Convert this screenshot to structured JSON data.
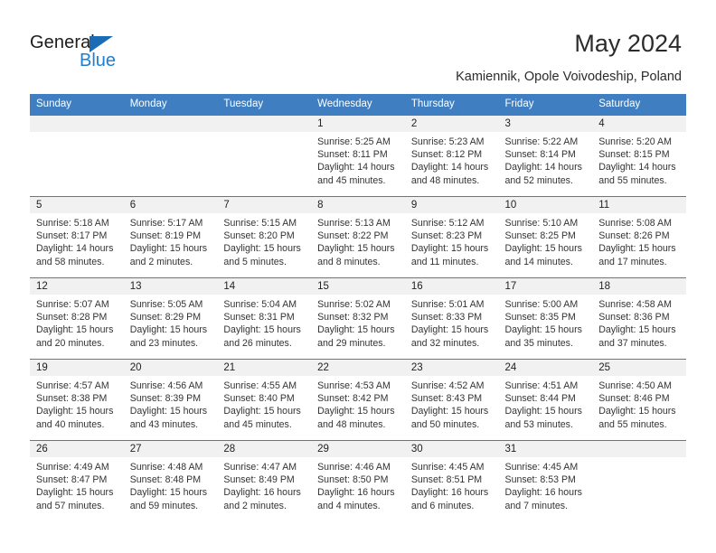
{
  "brand": {
    "name_top": "General",
    "name_bottom": "Blue",
    "logo_icon": "blue-triangle-icon",
    "accent_color": "#1c7fd0"
  },
  "header": {
    "title": "May 2024",
    "subtitle": "Kamiennik, Opole Voivodeship, Poland"
  },
  "calendar": {
    "header_bg": "#3f7fc1",
    "daynum_bg": "#f1f1f1",
    "weekday_headers": [
      "Sunday",
      "Monday",
      "Tuesday",
      "Wednesday",
      "Thursday",
      "Friday",
      "Saturday"
    ],
    "weeks": [
      [
        {
          "day": "",
          "lines": []
        },
        {
          "day": "",
          "lines": []
        },
        {
          "day": "",
          "lines": []
        },
        {
          "day": "1",
          "lines": [
            "Sunrise: 5:25 AM",
            "Sunset: 8:11 PM",
            "Daylight: 14 hours",
            "and 45 minutes."
          ]
        },
        {
          "day": "2",
          "lines": [
            "Sunrise: 5:23 AM",
            "Sunset: 8:12 PM",
            "Daylight: 14 hours",
            "and 48 minutes."
          ]
        },
        {
          "day": "3",
          "lines": [
            "Sunrise: 5:22 AM",
            "Sunset: 8:14 PM",
            "Daylight: 14 hours",
            "and 52 minutes."
          ]
        },
        {
          "day": "4",
          "lines": [
            "Sunrise: 5:20 AM",
            "Sunset: 8:15 PM",
            "Daylight: 14 hours",
            "and 55 minutes."
          ]
        }
      ],
      [
        {
          "day": "5",
          "lines": [
            "Sunrise: 5:18 AM",
            "Sunset: 8:17 PM",
            "Daylight: 14 hours",
            "and 58 minutes."
          ]
        },
        {
          "day": "6",
          "lines": [
            "Sunrise: 5:17 AM",
            "Sunset: 8:19 PM",
            "Daylight: 15 hours",
            "and 2 minutes."
          ]
        },
        {
          "day": "7",
          "lines": [
            "Sunrise: 5:15 AM",
            "Sunset: 8:20 PM",
            "Daylight: 15 hours",
            "and 5 minutes."
          ]
        },
        {
          "day": "8",
          "lines": [
            "Sunrise: 5:13 AM",
            "Sunset: 8:22 PM",
            "Daylight: 15 hours",
            "and 8 minutes."
          ]
        },
        {
          "day": "9",
          "lines": [
            "Sunrise: 5:12 AM",
            "Sunset: 8:23 PM",
            "Daylight: 15 hours",
            "and 11 minutes."
          ]
        },
        {
          "day": "10",
          "lines": [
            "Sunrise: 5:10 AM",
            "Sunset: 8:25 PM",
            "Daylight: 15 hours",
            "and 14 minutes."
          ]
        },
        {
          "day": "11",
          "lines": [
            "Sunrise: 5:08 AM",
            "Sunset: 8:26 PM",
            "Daylight: 15 hours",
            "and 17 minutes."
          ]
        }
      ],
      [
        {
          "day": "12",
          "lines": [
            "Sunrise: 5:07 AM",
            "Sunset: 8:28 PM",
            "Daylight: 15 hours",
            "and 20 minutes."
          ]
        },
        {
          "day": "13",
          "lines": [
            "Sunrise: 5:05 AM",
            "Sunset: 8:29 PM",
            "Daylight: 15 hours",
            "and 23 minutes."
          ]
        },
        {
          "day": "14",
          "lines": [
            "Sunrise: 5:04 AM",
            "Sunset: 8:31 PM",
            "Daylight: 15 hours",
            "and 26 minutes."
          ]
        },
        {
          "day": "15",
          "lines": [
            "Sunrise: 5:02 AM",
            "Sunset: 8:32 PM",
            "Daylight: 15 hours",
            "and 29 minutes."
          ]
        },
        {
          "day": "16",
          "lines": [
            "Sunrise: 5:01 AM",
            "Sunset: 8:33 PM",
            "Daylight: 15 hours",
            "and 32 minutes."
          ]
        },
        {
          "day": "17",
          "lines": [
            "Sunrise: 5:00 AM",
            "Sunset: 8:35 PM",
            "Daylight: 15 hours",
            "and 35 minutes."
          ]
        },
        {
          "day": "18",
          "lines": [
            "Sunrise: 4:58 AM",
            "Sunset: 8:36 PM",
            "Daylight: 15 hours",
            "and 37 minutes."
          ]
        }
      ],
      [
        {
          "day": "19",
          "lines": [
            "Sunrise: 4:57 AM",
            "Sunset: 8:38 PM",
            "Daylight: 15 hours",
            "and 40 minutes."
          ]
        },
        {
          "day": "20",
          "lines": [
            "Sunrise: 4:56 AM",
            "Sunset: 8:39 PM",
            "Daylight: 15 hours",
            "and 43 minutes."
          ]
        },
        {
          "day": "21",
          "lines": [
            "Sunrise: 4:55 AM",
            "Sunset: 8:40 PM",
            "Daylight: 15 hours",
            "and 45 minutes."
          ]
        },
        {
          "day": "22",
          "lines": [
            "Sunrise: 4:53 AM",
            "Sunset: 8:42 PM",
            "Daylight: 15 hours",
            "and 48 minutes."
          ]
        },
        {
          "day": "23",
          "lines": [
            "Sunrise: 4:52 AM",
            "Sunset: 8:43 PM",
            "Daylight: 15 hours",
            "and 50 minutes."
          ]
        },
        {
          "day": "24",
          "lines": [
            "Sunrise: 4:51 AM",
            "Sunset: 8:44 PM",
            "Daylight: 15 hours",
            "and 53 minutes."
          ]
        },
        {
          "day": "25",
          "lines": [
            "Sunrise: 4:50 AM",
            "Sunset: 8:46 PM",
            "Daylight: 15 hours",
            "and 55 minutes."
          ]
        }
      ],
      [
        {
          "day": "26",
          "lines": [
            "Sunrise: 4:49 AM",
            "Sunset: 8:47 PM",
            "Daylight: 15 hours",
            "and 57 minutes."
          ]
        },
        {
          "day": "27",
          "lines": [
            "Sunrise: 4:48 AM",
            "Sunset: 8:48 PM",
            "Daylight: 15 hours",
            "and 59 minutes."
          ]
        },
        {
          "day": "28",
          "lines": [
            "Sunrise: 4:47 AM",
            "Sunset: 8:49 PM",
            "Daylight: 16 hours",
            "and 2 minutes."
          ]
        },
        {
          "day": "29",
          "lines": [
            "Sunrise: 4:46 AM",
            "Sunset: 8:50 PM",
            "Daylight: 16 hours",
            "and 4 minutes."
          ]
        },
        {
          "day": "30",
          "lines": [
            "Sunrise: 4:45 AM",
            "Sunset: 8:51 PM",
            "Daylight: 16 hours",
            "and 6 minutes."
          ]
        },
        {
          "day": "31",
          "lines": [
            "Sunrise: 4:45 AM",
            "Sunset: 8:53 PM",
            "Daylight: 16 hours",
            "and 7 minutes."
          ]
        },
        {
          "day": "",
          "lines": []
        }
      ]
    ]
  }
}
